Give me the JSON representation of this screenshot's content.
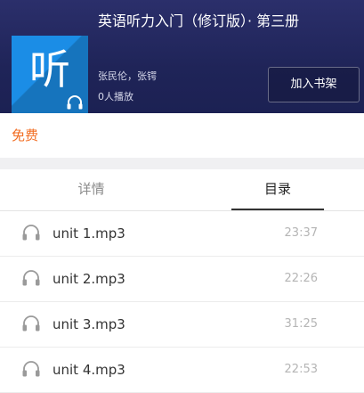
{
  "album": {
    "title": "英语听力入门（修订版）· 第三册",
    "cover_char": "听",
    "authors": "张民伦，张锷",
    "plays": "0人播放",
    "add_to_shelf": "加入书架"
  },
  "price": {
    "label": "免费",
    "color": "#f26d22"
  },
  "tabs": [
    {
      "label": "详情",
      "active": false
    },
    {
      "label": "目录",
      "active": true
    }
  ],
  "tracks": [
    {
      "name": "unit 1.mp3",
      "duration": "23:37",
      "icon": "headphones-icon"
    },
    {
      "name": "unit 2.mp3",
      "duration": "22:26",
      "icon": "headphones-icon"
    },
    {
      "name": "unit 3.mp3",
      "duration": "31:25",
      "icon": "headphones-icon"
    },
    {
      "name": "unit 4.mp3",
      "duration": "22:53",
      "icon": "headphones-icon"
    }
  ]
}
